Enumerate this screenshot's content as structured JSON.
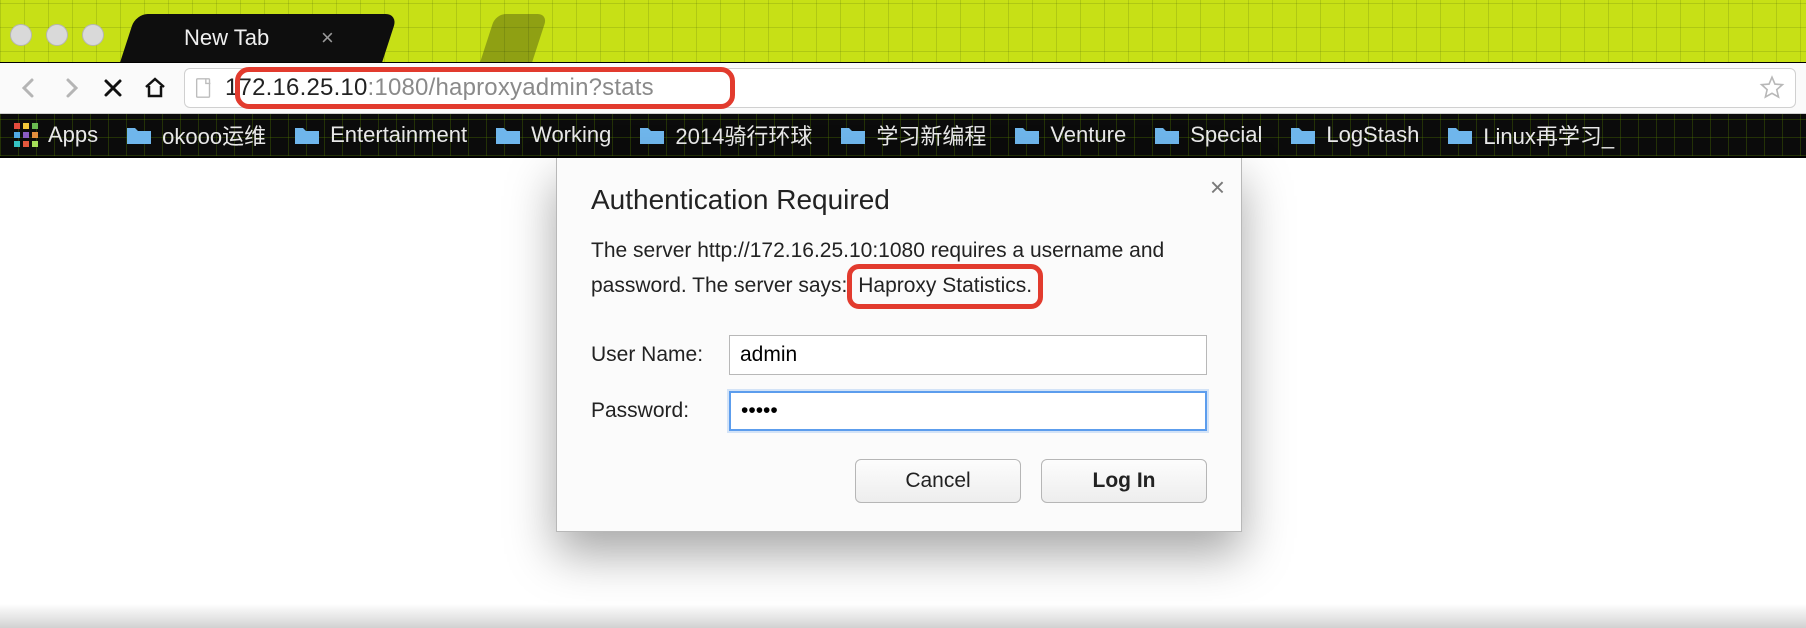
{
  "tab": {
    "title": "New Tab"
  },
  "url": {
    "host": "172.16.25.10",
    "rest": ":1080/haproxyadmin?stats"
  },
  "bookmarks": {
    "apps_label": "Apps",
    "items": [
      {
        "label": "okooo运维"
      },
      {
        "label": "Entertainment"
      },
      {
        "label": "Working"
      },
      {
        "label": "2014骑行环球"
      },
      {
        "label": "学习新编程"
      },
      {
        "label": "Venture"
      },
      {
        "label": "Special"
      },
      {
        "label": "LogStash"
      },
      {
        "label": "Linux再学习_"
      }
    ]
  },
  "dialog": {
    "title": "Authentication Required",
    "message_pre": "The server http://172.16.25.10:1080 requires a username and password. The server says: ",
    "realm": "Haproxy Statistics.",
    "username_label": "User Name:",
    "password_label": "Password:",
    "username_value": "admin",
    "password_value": "•••••",
    "cancel": "Cancel",
    "login": "Log In"
  }
}
